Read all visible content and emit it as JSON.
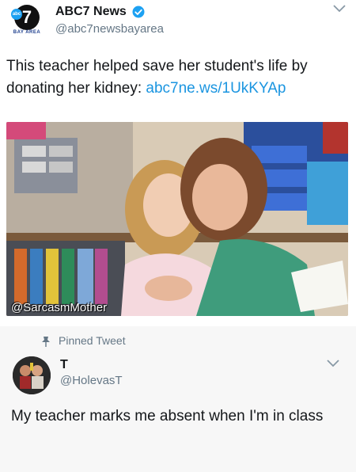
{
  "tweet": {
    "logo": {
      "number": "7",
      "mark": "abc",
      "subtitle": "BAY AREA"
    },
    "display_name": "ABC7 News",
    "handle": "@abc7newsbayarea",
    "text": "This teacher helped save her student's life by donating her kidney: ",
    "link": "abc7ne.ws/1UkKYAp",
    "photo_watermark": "@SarcasmMother",
    "verified_icon": "verified-badge-icon",
    "menu_icon": "chevron-down-icon",
    "colors": {
      "link": "#1b95e0",
      "verified": "#1da1f2",
      "muted": "#657786"
    }
  },
  "reply": {
    "pinned_label": "Pinned Tweet",
    "display_name": "T",
    "handle": "@HolevasT",
    "text": "My teacher marks me absent when I'm in class",
    "pin_icon": "pin-icon",
    "menu_icon": "chevron-down-icon"
  }
}
